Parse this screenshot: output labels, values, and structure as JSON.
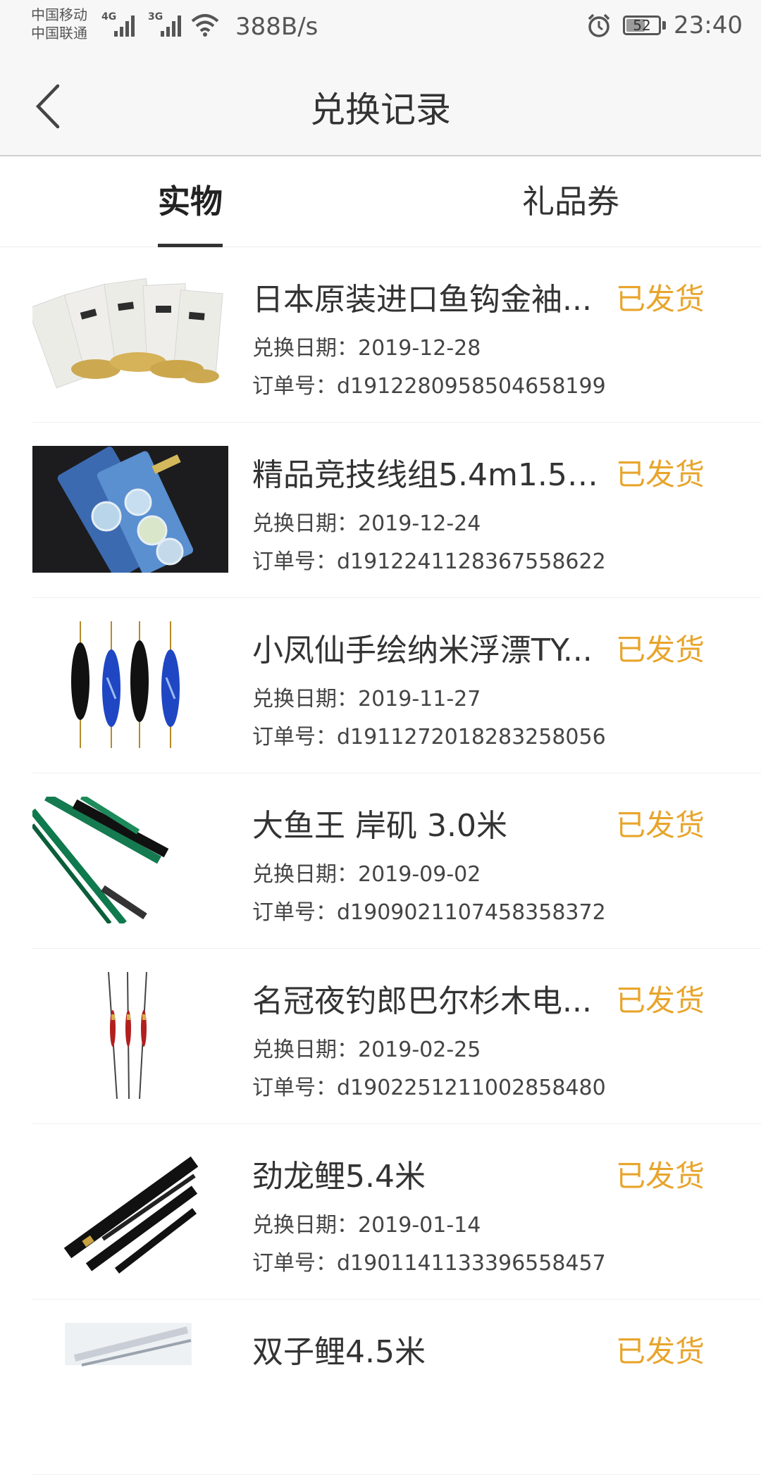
{
  "status_bar": {
    "carrier_1": "中国移动",
    "carrier_2": "中国联通",
    "net_1": "4G",
    "net_2": "3G",
    "speed": "388B/s",
    "battery": "52",
    "time": "23:40"
  },
  "header": {
    "title": "兑换记录"
  },
  "tabs": [
    {
      "label": "实物",
      "active": true
    },
    {
      "label": "礼品券",
      "active": false
    }
  ],
  "list": {
    "date_prefix": "兑换日期：",
    "order_prefix": "订单号：",
    "items": [
      {
        "name": "日本原装进口鱼钩金袖...",
        "date": "2019-12-28",
        "order": "d1912280958504658199",
        "status": "已发货",
        "thumb": "fish-hooks"
      },
      {
        "name": "精品竞技线组5.4m1.5#...",
        "date": "2019-12-24",
        "order": "d1912241128367558622",
        "status": "已发货",
        "thumb": "fishing-line"
      },
      {
        "name": "小凤仙手绘纳米浮漂TY...",
        "date": "2019-11-27",
        "order": "d1911272018283258056",
        "status": "已发货",
        "thumb": "floats"
      },
      {
        "name": "大鱼王 岸矶 3.0米",
        "date": "2019-09-02",
        "order": "d1909021107458358372",
        "status": "已发货",
        "thumb": "rod-green"
      },
      {
        "name": "名冠夜钓郎巴尔杉木电...",
        "date": "2019-02-25",
        "order": "d1902251211002858480",
        "status": "已发货",
        "thumb": "night-floats"
      },
      {
        "name": "劲龙鲤5.4米",
        "date": "2019-01-14",
        "order": "d1901141133396558457",
        "status": "已发货",
        "thumb": "rod-black"
      },
      {
        "name": "双子鲤4.5米",
        "date": "",
        "order": "",
        "status": "已发货",
        "thumb": "rod-white"
      }
    ]
  }
}
